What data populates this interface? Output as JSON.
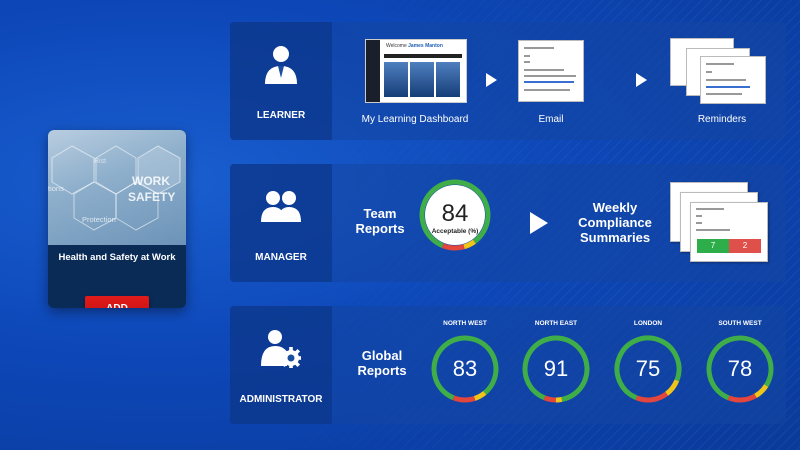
{
  "course": {
    "title": "Health and Safety at Work",
    "add_label": "ADD",
    "image_words": [
      "WORK",
      "SAFETY",
      "Protection",
      "tions",
      "Rist"
    ]
  },
  "learner": {
    "role": "LEARNER",
    "dashboard_caption": "My Learning Dashboard",
    "dashboard_welcome": "Welcome",
    "dashboard_user": "James Manton",
    "email_caption": "Email",
    "reminders_caption": "Reminders"
  },
  "manager": {
    "role": "MANAGER",
    "team_reports": [
      "Team",
      "Reports"
    ],
    "score": "84",
    "score_label": "Acceptable (%)",
    "weekly": [
      "Weekly",
      "Compliance",
      "Summaries"
    ],
    "summary_green": "7",
    "summary_red": "2"
  },
  "administrator": {
    "role": "ADMINISTRATOR",
    "global_reports": [
      "Global",
      "Reports"
    ],
    "regions": [
      {
        "name": "NORTH WEST",
        "value": "83"
      },
      {
        "name": "NORTH EAST",
        "value": "91"
      },
      {
        "name": "LONDON",
        "value": "75"
      },
      {
        "name": "SOUTH WEST",
        "value": "78"
      }
    ]
  },
  "colors": {
    "gauge_green": "#3fae49",
    "gauge_yellow": "#f0c419",
    "gauge_red": "#e2463c",
    "add_red": "#d61414"
  }
}
